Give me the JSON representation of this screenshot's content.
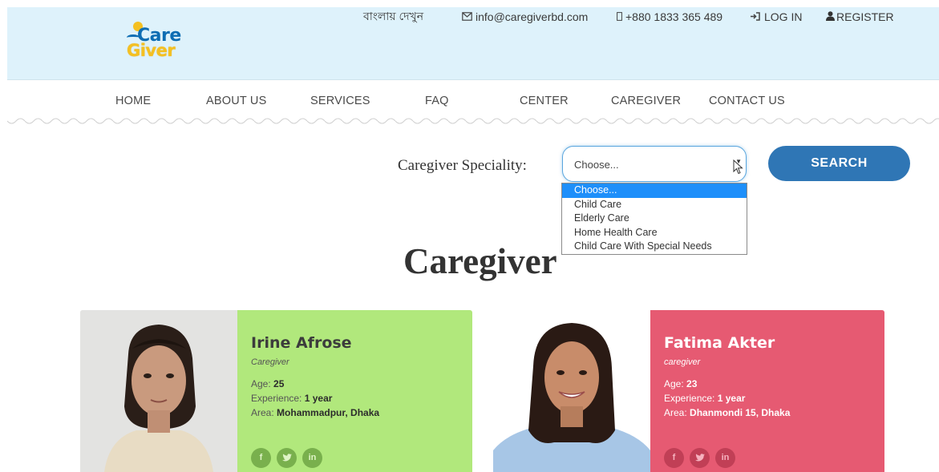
{
  "header": {
    "logo_text_top": "Care",
    "logo_text_bottom": "Giver",
    "language_link": "বাংলায় দেখুন",
    "email": "info@caregiverbd.com",
    "phone": "+880 1833 365 489",
    "login_label": "LOG IN",
    "register_label": "REGISTER"
  },
  "nav": {
    "items": [
      "HOME",
      "ABOUT US",
      "SERVICES",
      "FAQ",
      "CENTER",
      "CAREGIVER",
      "CONTACT US"
    ]
  },
  "search": {
    "label": "Caregiver Speciality:",
    "selected": "Choose...",
    "options": [
      "Choose...",
      "Child Care",
      "Elderly Care",
      "Home Health Care",
      "Child Care With Special Needs"
    ],
    "button_label": "SEARCH"
  },
  "section": {
    "title": "Caregiver"
  },
  "caregivers": [
    {
      "name": "Irine Afrose",
      "role": "Caregiver",
      "age_label": "Age:",
      "age": "25",
      "experience_label": "Experience:",
      "experience": "1 year",
      "area_label": "Area:",
      "area": "Mohammadpur, Dhaka"
    },
    {
      "name": "Fatima Akter",
      "role": "caregiver",
      "age_label": "Age:",
      "age": "23",
      "experience_label": "Experience:",
      "experience": "1 year",
      "area_label": "Area:",
      "area": "Dhanmondi 15, Dhaka"
    }
  ],
  "social": {
    "facebook": "f",
    "twitter": "t",
    "linkedin": "in"
  },
  "colors": {
    "header_bg": "#def2fb",
    "accent_blue": "#2f76b5",
    "card_green": "#b1e87c",
    "card_pink": "#e65a72"
  }
}
